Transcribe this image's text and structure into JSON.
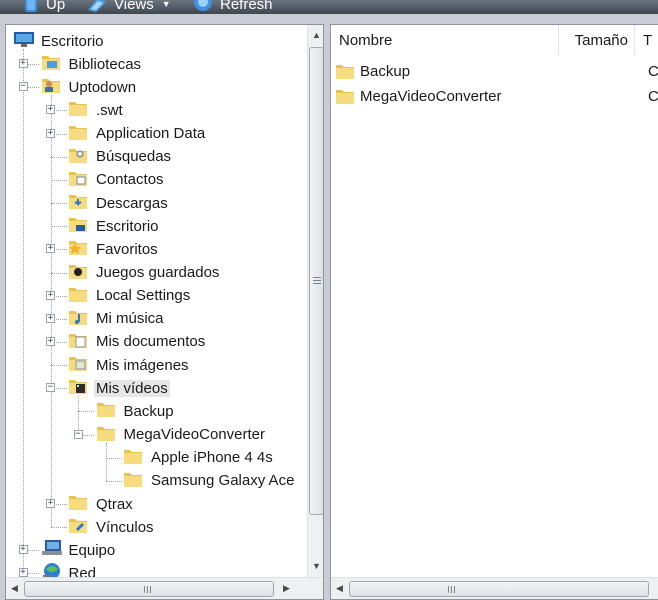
{
  "toolbar": {
    "up_label": "Up",
    "views_label": "Views",
    "refresh_label": "Refresh"
  },
  "tree": [
    {
      "label": "Escritorio",
      "icon": "desktop-icon"
    },
    {
      "label": "Bibliotecas",
      "icon": "libraries-icon"
    },
    {
      "label": "Uptodown",
      "icon": "user-folder-icon"
    },
    {
      "label": ".swt",
      "icon": "folder-icon"
    },
    {
      "label": "Application Data",
      "icon": "folder-icon"
    },
    {
      "label": "Búsquedas",
      "icon": "searches-folder-icon"
    },
    {
      "label": "Contactos",
      "icon": "contacts-folder-icon"
    },
    {
      "label": "Descargas",
      "icon": "downloads-folder-icon"
    },
    {
      "label": "Escritorio",
      "icon": "desktop-folder-icon"
    },
    {
      "label": "Favoritos",
      "icon": "favorites-folder-icon"
    },
    {
      "label": "Juegos guardados",
      "icon": "saved-games-folder-icon"
    },
    {
      "label": "Local Settings",
      "icon": "folder-icon"
    },
    {
      "label": "Mi música",
      "icon": "music-folder-icon"
    },
    {
      "label": "Mis documentos",
      "icon": "documents-folder-icon"
    },
    {
      "label": "Mis imágenes",
      "icon": "pictures-folder-icon"
    },
    {
      "label": "Mis vídeos",
      "icon": "videos-folder-icon"
    },
    {
      "label": "Backup",
      "icon": "folder-icon"
    },
    {
      "label": "MegaVideoConverter",
      "icon": "folder-icon"
    },
    {
      "label": "Apple iPhone 4 4s",
      "icon": "folder-icon"
    },
    {
      "label": "Samsung Galaxy Ace",
      "icon": "folder-icon"
    },
    {
      "label": "Qtrax",
      "icon": "folder-icon"
    },
    {
      "label": "Vínculos",
      "icon": "links-folder-icon"
    },
    {
      "label": "Equipo",
      "icon": "computer-icon"
    },
    {
      "label": "Red",
      "icon": "network-icon"
    }
  ],
  "list": {
    "columns": [
      "Nombre",
      "Tamaño",
      "T"
    ],
    "rows": [
      {
        "name": "Backup",
        "type": "C"
      },
      {
        "name": "MegaVideoConverter",
        "type": "C"
      }
    ]
  },
  "colors": {
    "folder": "#f2d46b",
    "toolbar": "#4a535c",
    "selection": "#e6e6e6"
  }
}
